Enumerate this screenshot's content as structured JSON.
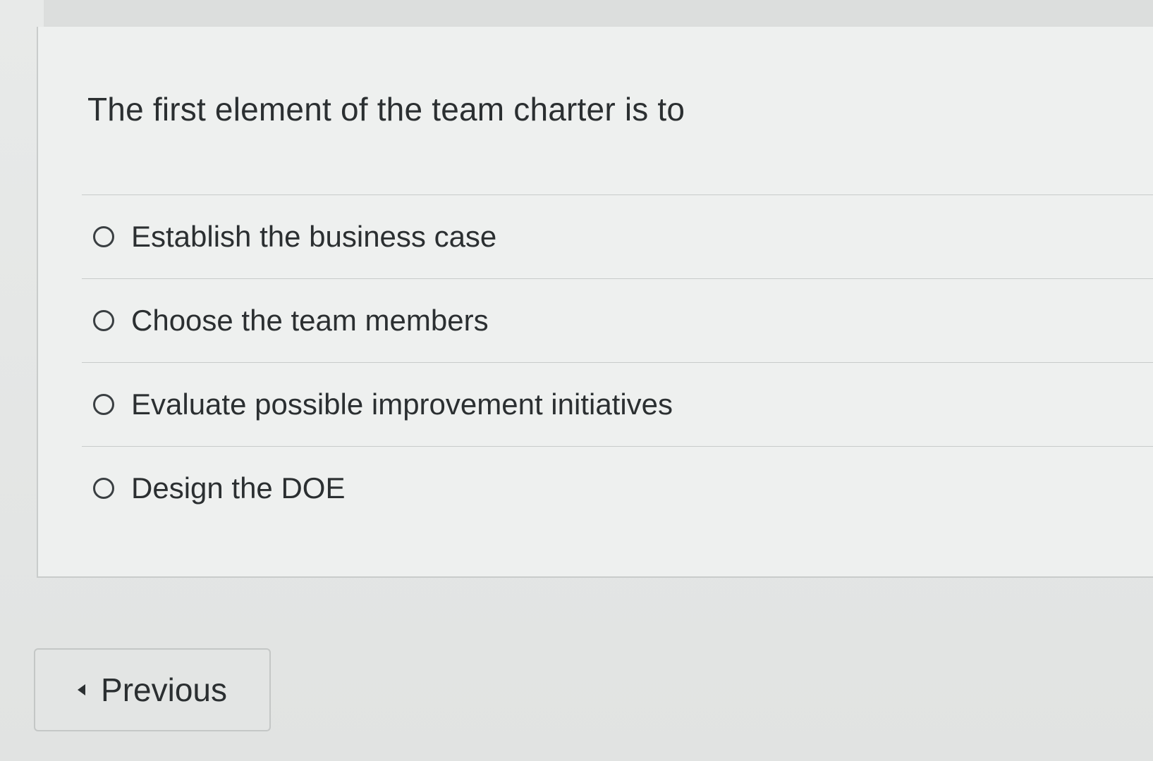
{
  "question": {
    "text": "The first element of the team charter is to"
  },
  "answers": [
    {
      "label": "Establish the business case",
      "selected": false
    },
    {
      "label": "Choose the team members",
      "selected": false
    },
    {
      "label": "Evaluate possible improvement initiatives",
      "selected": false
    },
    {
      "label": "Design the DOE",
      "selected": false
    }
  ],
  "navigation": {
    "previous_label": "Previous",
    "previous_icon": "caret-left-icon"
  }
}
